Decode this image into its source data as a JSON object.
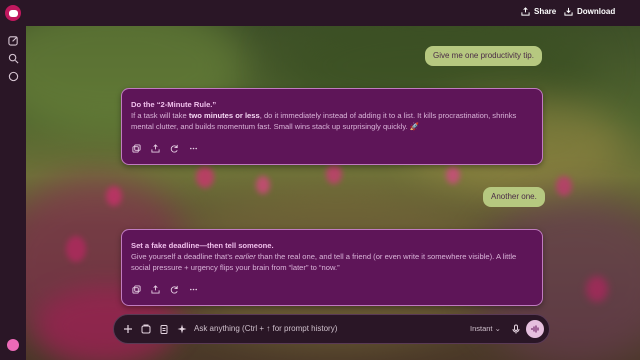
{
  "topbar": {
    "share_label": "Share",
    "download_label": "Download"
  },
  "messages": {
    "user1": "Give me one productivity tip.",
    "ai1": {
      "title": "Do the “2-Minute Rule.”",
      "text_before": "If a task will take ",
      "bold": "two minutes or less",
      "text_after": ", do it immediately instead of adding it to a list. It kills procrastination, shrinks mental clutter, and builds momentum fast. Small wins stack up surprisingly quickly. 🚀"
    },
    "user2": "Another one.",
    "ai2": {
      "title": "Set a fake deadline—then tell someone.",
      "text_before": "Give yourself a deadline that’s ",
      "italic": "earlier",
      "text_after": " than the real one, and tell a friend (or even write it somewhere visible). A little social pressure + urgency flips your brain from “later” to “now.”"
    }
  },
  "composer": {
    "placeholder": "Ask anything (Ctrl + ↑ for prompt history)",
    "mode_label": "Instant ⌄"
  },
  "colors": {
    "accent": "#c0185e",
    "bubble_user": "#b6c880",
    "bubble_ai": "#5e1558"
  },
  "icons": [
    "new-chat-icon",
    "search-icon",
    "chat-icon",
    "share-icon",
    "download-icon",
    "copy-icon",
    "export-icon",
    "regenerate-icon",
    "more-icon",
    "plus-icon",
    "image-icon",
    "clipboard-icon",
    "sparkle-icon",
    "mic-icon",
    "voice-icon"
  ]
}
